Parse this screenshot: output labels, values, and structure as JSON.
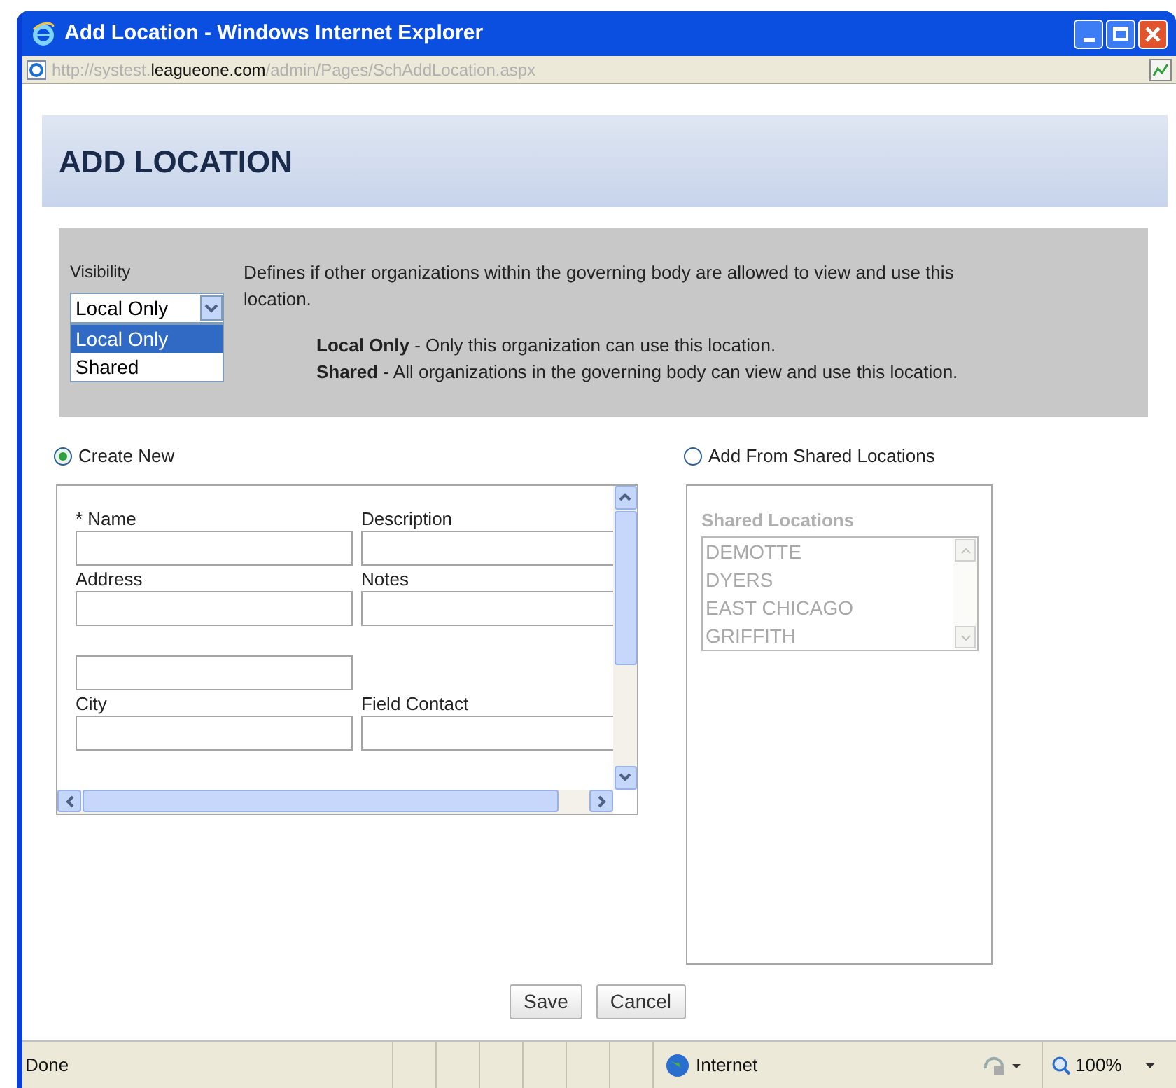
{
  "window": {
    "title": "Add Location - Windows Internet Explorer"
  },
  "address_bar": {
    "url_parts": [
      {
        "text": "http://systest.",
        "kind": "dim"
      },
      {
        "text": "leagueone.com",
        "kind": "host"
      },
      {
        "text": "/admin/Pages/SchAddLocation.aspx",
        "kind": "dim"
      }
    ]
  },
  "page_title": "ADD LOCATION",
  "visibility": {
    "label": "Visibility",
    "value": "Local Only",
    "expanded": true,
    "options": [
      {
        "label": "Local Only",
        "selected": true
      },
      {
        "label": "Shared",
        "selected": false
      }
    ],
    "description": "Defines if other organizations within the governing body are allowed to view and use this location.",
    "notes": [
      "**Local Only** - Only this organization can use this location.",
      "**Shared** - All organizations in the governing body can view and use this location."
    ]
  },
  "source_options": [
    {
      "label": "Create New",
      "selected": true
    },
    {
      "label": "Add From Shared Locations",
      "selected": false
    }
  ],
  "form": {
    "rows": [
      [
        {
          "kind": "labeled_input",
          "label": "* Name"
        },
        {
          "kind": "labeled_input",
          "label": "Description"
        }
      ],
      [
        {
          "kind": "labeled_input",
          "label": "Address"
        },
        {
          "kind": "labeled_input",
          "label": "Notes"
        }
      ],
      [
        {
          "kind": "input"
        }
      ],
      [
        {
          "kind": "labeled_input",
          "label": "City"
        },
        {
          "kind": "labeled_input",
          "label": "Field Contact"
        }
      ]
    ]
  },
  "shared_locations": {
    "label": "Shared Locations",
    "disabled": true,
    "items": [
      "DEMOTTE",
      "DYERS",
      "EAST CHICAGO",
      "GRIFFITH"
    ]
  },
  "buttons": [
    "Save",
    "Cancel"
  ],
  "status_bar": {
    "text": "Done",
    "zone": "Internet",
    "zoom": "100%"
  }
}
